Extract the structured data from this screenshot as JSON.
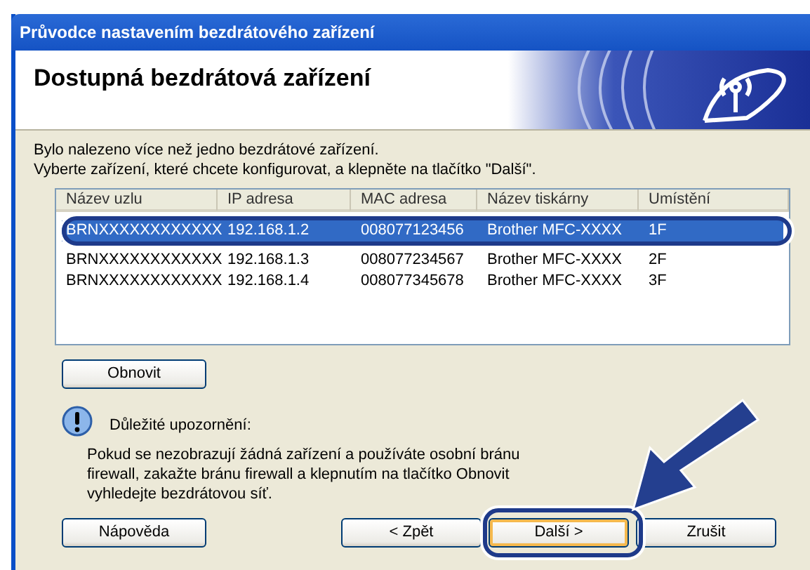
{
  "window": {
    "title": "Průvodce nastavením bezdrátového zařízení"
  },
  "header": {
    "title": "Dostupná bezdrátová zařízení"
  },
  "instructions": [
    "Bylo nalezeno více než jedno bezdrátové zařízení.",
    "Vyberte zařízení, které chcete konfigurovat, a klepněte na tlačítko \"Další\"."
  ],
  "device_list": {
    "columns": [
      "Název uzlu",
      "IP adresa",
      "MAC adresa",
      "Název tiskárny",
      "Umístění"
    ],
    "rows": [
      {
        "cells": [
          "BRNXXXXXXXXXXXX",
          "192.168.1.2",
          "008077123456",
          "Brother MFC-XXXX",
          "1F"
        ],
        "selected": true,
        "callout": true
      },
      {
        "cells": [
          "BRNXXXXXXXXXXXX",
          "192.168.1.3",
          "008077234567",
          "Brother MFC-XXXX",
          "2F"
        ],
        "selected": false,
        "callout": false
      },
      {
        "cells": [
          "BRNXXXXXXXXXXXX",
          "192.168.1.4",
          "008077345678",
          "Brother MFC-XXXX",
          "3F"
        ],
        "selected": false,
        "callout": false
      }
    ]
  },
  "refresh_button": {
    "label": "Obnovit"
  },
  "notice": {
    "heading": "Důležité upozornění:",
    "text": "Pokud se nezobrazují žádná zařízení a používáte osobní bránu firewall, zakažte bránu firewall a klepnutím na tlačítko Obnovit vyhledejte bezdrátovou síť."
  },
  "buttons": [
    {
      "label": "Nápověda",
      "default": false,
      "callout": false
    },
    {
      "label": "< Zpět",
      "default": false,
      "callout": false
    },
    {
      "label": "Další >",
      "default": true,
      "callout": true
    },
    {
      "label": "Zrušit",
      "default": false,
      "callout": false
    }
  ]
}
